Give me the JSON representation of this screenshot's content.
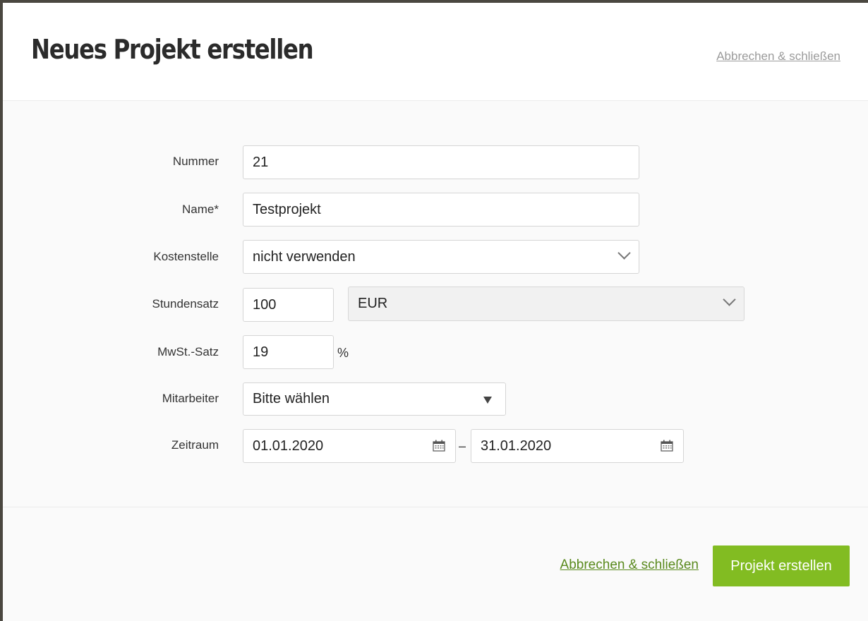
{
  "dialog": {
    "title": "Neues Projekt erstellen",
    "header_cancel": "Abbrechen & schließen"
  },
  "form": {
    "number": {
      "label": "Nummer",
      "value": "21"
    },
    "name": {
      "label": "Name*",
      "value": "Testprojekt"
    },
    "cost_center": {
      "label": "Kostenstelle",
      "value": "nicht verwenden"
    },
    "hourly_rate": {
      "label": "Stundensatz",
      "value": "100",
      "currency": "EUR"
    },
    "vat": {
      "label": "MwSt.-Satz",
      "value": "19",
      "unit": "%"
    },
    "employee": {
      "label": "Mitarbeiter",
      "value": "Bitte wählen"
    },
    "period": {
      "label": "Zeitraum",
      "start": "01.01.2020",
      "separator": "–",
      "end": "31.01.2020"
    }
  },
  "footer": {
    "cancel": "Abbrechen & schließen",
    "submit": "Projekt erstellen"
  },
  "colors": {
    "accent": "#82bc22",
    "link_green": "#5a8a1e"
  }
}
